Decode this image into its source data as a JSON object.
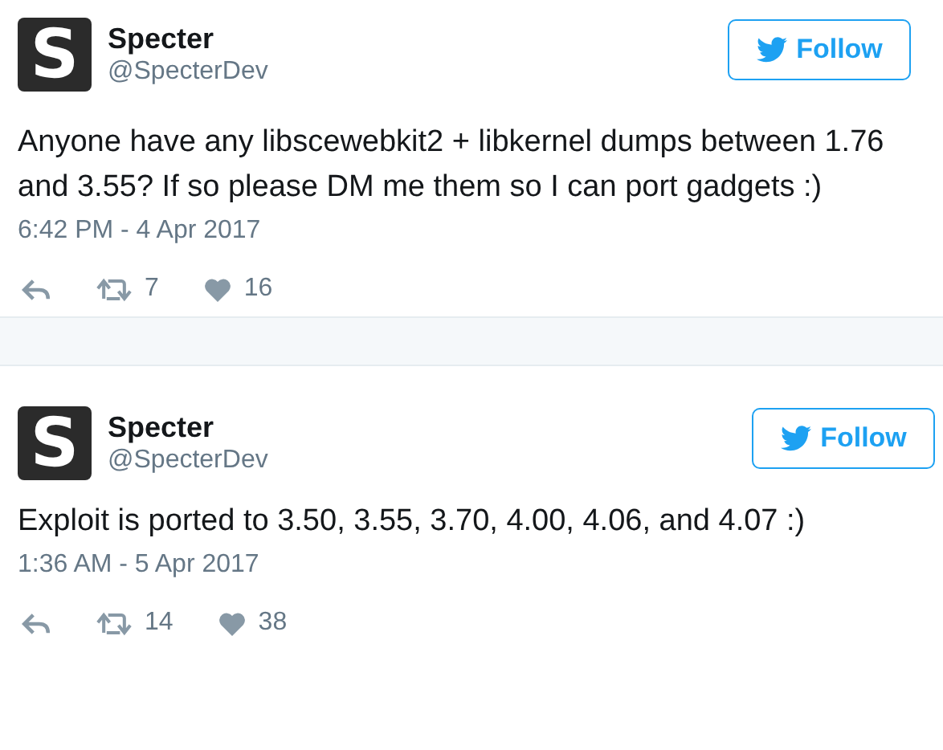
{
  "tweets": [
    {
      "avatar_letter": "S",
      "name": "Specter",
      "handle": "@SpecterDev",
      "follow": "Follow",
      "text": "Anyone have any libscewebkit2 + libkernel dumps between 1.76 and 3.55? If so please DM me them so I can port gadgets :)",
      "time": "6:42 PM - 4 Apr 2017",
      "retweets": "7",
      "likes": "16"
    },
    {
      "avatar_letter": "S",
      "name": "Specter",
      "handle": "@SpecterDev",
      "follow": "Follow",
      "text": "Exploit is ported to 3.50, 3.55, 3.70, 4.00, 4.06, and 4.07 :)",
      "time": "1:36 AM - 5 Apr 2017",
      "retweets": "14",
      "likes": "38"
    }
  ]
}
